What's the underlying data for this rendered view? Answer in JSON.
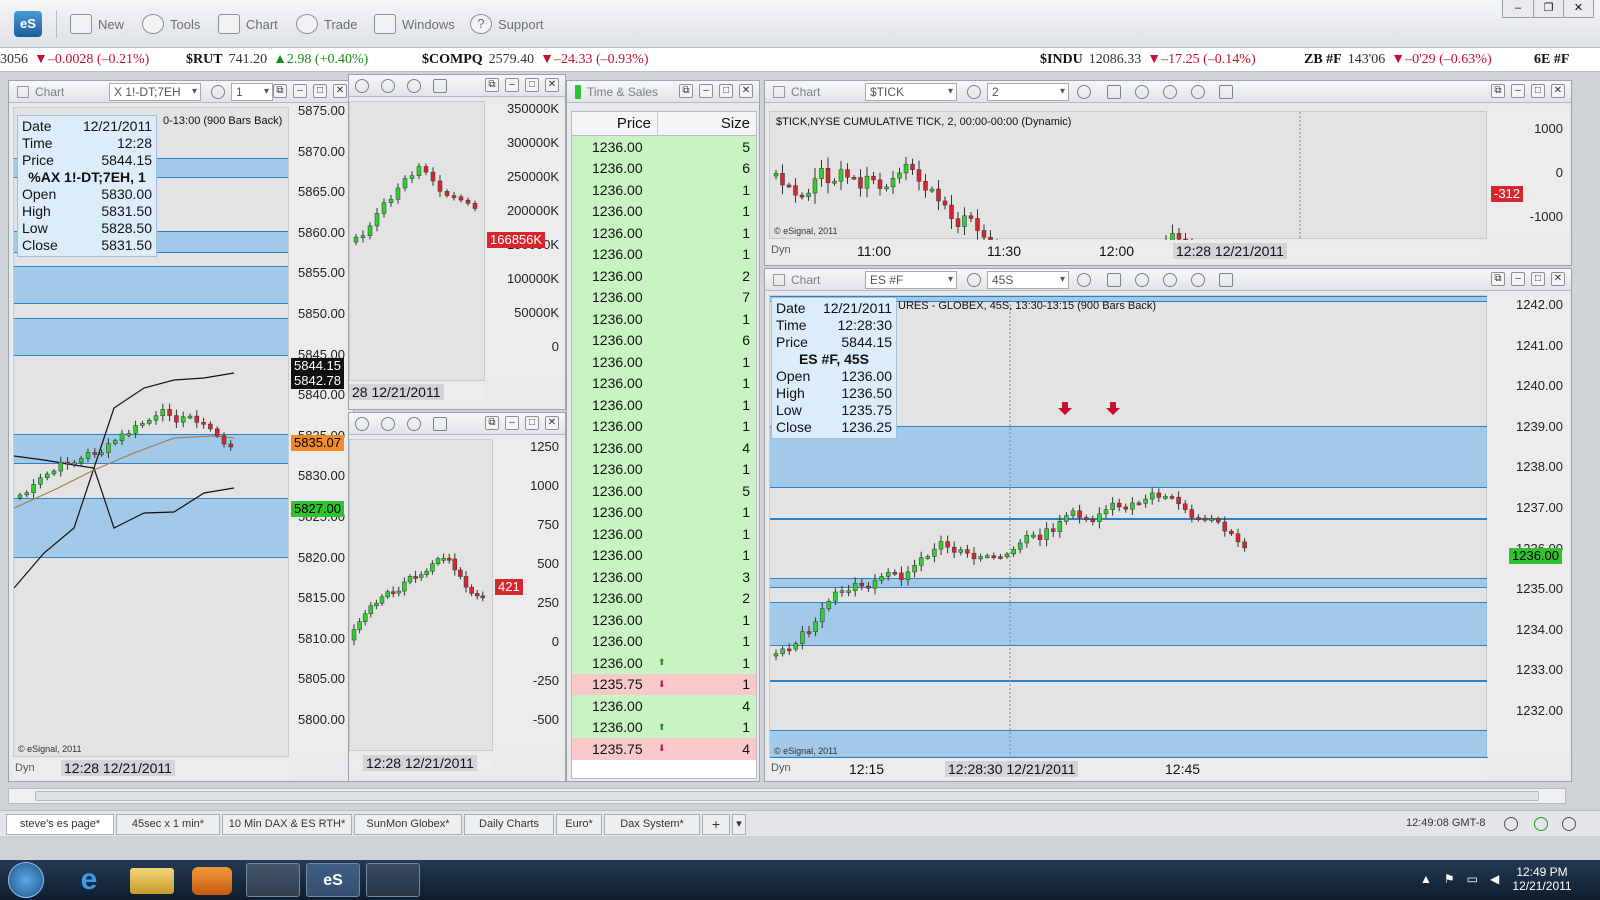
{
  "toolbar": {
    "logo": "eS",
    "buttons": [
      "New",
      "Tools",
      "Chart",
      "Trade",
      "Windows",
      "Support"
    ]
  },
  "ticker": [
    {
      "sym": "",
      "last": "3056",
      "chg": "▼–0.0028 (–0.21%)",
      "dir": "neg"
    },
    {
      "sym": "$RUT",
      "last": "741.20",
      "chg": "▲2.98 (+0.40%)",
      "dir": "pos"
    },
    {
      "sym": "$COMPQ",
      "last": "2579.40",
      "chg": "▼–24.33 (–0.93%)",
      "dir": "neg"
    },
    {
      "sym": "$INDU",
      "last": "12086.33",
      "chg": "▼–17.25 (–0.14%)",
      "dir": "neg"
    },
    {
      "sym": "ZB #F",
      "last": "143'06",
      "chg": "▼–0'29 (–0.63%)",
      "dir": "neg"
    },
    {
      "sym": "6E #F",
      "last": "",
      "chg": "",
      "dir": "neg"
    }
  ],
  "dax_chart": {
    "title": "Chart",
    "symbol_combo": "X 1!-DT;7EH",
    "interval_combo": "1",
    "subtitle": "0-13:00 (900 Bars Back)",
    "info": {
      "date_l": "Date",
      "date": "12/21/2011",
      "time_l": "Time",
      "time": "12:28",
      "price_l": "Price",
      "price": "5844.15",
      "sym": "%AX 1!-DT;7EH, 1",
      "open_l": "Open",
      "open": "5830.00",
      "high_l": "High",
      "high": "5831.50",
      "low_l": "Low",
      "low": "5828.50",
      "close_l": "Close",
      "close": "5831.50"
    },
    "axis": [
      "5875.00",
      "5870.00",
      "5865.00",
      "5860.00",
      "5855.00",
      "5850.00",
      "5845.00",
      "5840.00",
      "5835.00",
      "5830.00",
      "5825.00",
      "5820.00",
      "5815.00",
      "5810.00",
      "5805.00",
      "5800.00"
    ],
    "tags": {
      "t1": "5844.15",
      "t2": "5842.78",
      "t3": "5835.07",
      "t4": "5827.00"
    },
    "watermark": "© eSignal, 2011",
    "dyn": "Dyn",
    "time_label": "12:28 12/21/2011"
  },
  "vol_chart": {
    "axis": [
      "350000K",
      "300000K",
      "250000K",
      "200000K",
      "150000K",
      "100000K",
      "50000K",
      "0"
    ],
    "tag": "166856K",
    "time_label": "28 12/21/2011"
  },
  "osc_chart": {
    "axis": [
      "1250",
      "1000",
      "750",
      "500",
      "250",
      "0",
      "-250",
      "-500"
    ],
    "tag": "421",
    "time_label": "12:28 12/21/2011"
  },
  "time_sales": {
    "title": "Time & Sales",
    "col_price": "Price",
    "col_size": "Size",
    "rows": [
      {
        "p": "1236.00",
        "s": "5",
        "t": "buy",
        "a": ""
      },
      {
        "p": "1236.00",
        "s": "6",
        "t": "buy",
        "a": ""
      },
      {
        "p": "1236.00",
        "s": "1",
        "t": "buy",
        "a": ""
      },
      {
        "p": "1236.00",
        "s": "1",
        "t": "buy",
        "a": ""
      },
      {
        "p": "1236.00",
        "s": "1",
        "t": "buy",
        "a": ""
      },
      {
        "p": "1236.00",
        "s": "1",
        "t": "buy",
        "a": ""
      },
      {
        "p": "1236.00",
        "s": "2",
        "t": "buy",
        "a": ""
      },
      {
        "p": "1236.00",
        "s": "7",
        "t": "buy",
        "a": ""
      },
      {
        "p": "1236.00",
        "s": "1",
        "t": "buy",
        "a": ""
      },
      {
        "p": "1236.00",
        "s": "6",
        "t": "buy",
        "a": ""
      },
      {
        "p": "1236.00",
        "s": "1",
        "t": "buy",
        "a": ""
      },
      {
        "p": "1236.00",
        "s": "1",
        "t": "buy",
        "a": ""
      },
      {
        "p": "1236.00",
        "s": "1",
        "t": "buy",
        "a": ""
      },
      {
        "p": "1236.00",
        "s": "1",
        "t": "buy",
        "a": ""
      },
      {
        "p": "1236.00",
        "s": "4",
        "t": "buy",
        "a": ""
      },
      {
        "p": "1236.00",
        "s": "1",
        "t": "buy",
        "a": ""
      },
      {
        "p": "1236.00",
        "s": "5",
        "t": "buy",
        "a": ""
      },
      {
        "p": "1236.00",
        "s": "1",
        "t": "buy",
        "a": ""
      },
      {
        "p": "1236.00",
        "s": "1",
        "t": "buy",
        "a": ""
      },
      {
        "p": "1236.00",
        "s": "1",
        "t": "buy",
        "a": ""
      },
      {
        "p": "1236.00",
        "s": "3",
        "t": "buy",
        "a": ""
      },
      {
        "p": "1236.00",
        "s": "2",
        "t": "buy",
        "a": ""
      },
      {
        "p": "1236.00",
        "s": "1",
        "t": "buy",
        "a": ""
      },
      {
        "p": "1236.00",
        "s": "1",
        "t": "buy",
        "a": ""
      },
      {
        "p": "1236.00",
        "s": "1",
        "t": "buy",
        "a": "⬆"
      },
      {
        "p": "1235.75",
        "s": "1",
        "t": "sell",
        "a": "⬇"
      },
      {
        "p": "1236.00",
        "s": "4",
        "t": "buy",
        "a": ""
      },
      {
        "p": "1236.00",
        "s": "1",
        "t": "buy",
        "a": "⬆"
      },
      {
        "p": "1235.75",
        "s": "4",
        "t": "sell",
        "a": "⬇"
      }
    ]
  },
  "tick_chart": {
    "title": "Chart",
    "symbol_combo": "$TICK",
    "interval_combo": "2",
    "subtitle": "$TICK,NYSE CUMULATIVE TICK, 2, 00:00-00:00 (Dynamic)",
    "axis": [
      "1000",
      "0",
      "-1000"
    ],
    "tag": "-312",
    "watermark": "© eSignal, 2011",
    "dyn": "Dyn",
    "x_labels": [
      "11:00",
      "11:30",
      "12:00",
      "12:28 12/21/2011"
    ]
  },
  "es_chart": {
    "title": "Chart",
    "symbol_combo": "ES #F",
    "interval_combo": "45S",
    "subtitle": "URES - GLOBEX, 45S, 13:30-13:15 (900 Bars Back)",
    "info": {
      "date_l": "Date",
      "date": "12/21/2011",
      "time_l": "Time",
      "time": "12:28:30",
      "price_l": "Price",
      "price": "5844.15",
      "sym": "ES #F, 45S",
      "open_l": "Open",
      "open": "1236.00",
      "high_l": "High",
      "high": "1236.50",
      "low_l": "Low",
      "low": "1235.75",
      "close_l": "Close",
      "close": "1236.25"
    },
    "axis": [
      "1242.00",
      "1241.00",
      "1240.00",
      "1239.00",
      "1238.00",
      "1237.00",
      "1236.00",
      "1235.00",
      "1234.00",
      "1233.00",
      "1232.00"
    ],
    "tag": "1236.00",
    "watermark": "© eSignal, 2011",
    "dyn": "Dyn",
    "x_labels": [
      "12:15",
      "12:28:30 12/21/2011",
      "12:45"
    ]
  },
  "tabs": [
    "steve's es page*",
    "45sec x 1 min*",
    "10 Min DAX & ES RTH*",
    "SunMon Globex*",
    "Daily Charts",
    "Euro*",
    "Dax System*",
    "+"
  ],
  "status_time": "12:49:08 GMT-8",
  "tray": {
    "time": "12:49 PM",
    "date": "12/21/2011"
  }
}
